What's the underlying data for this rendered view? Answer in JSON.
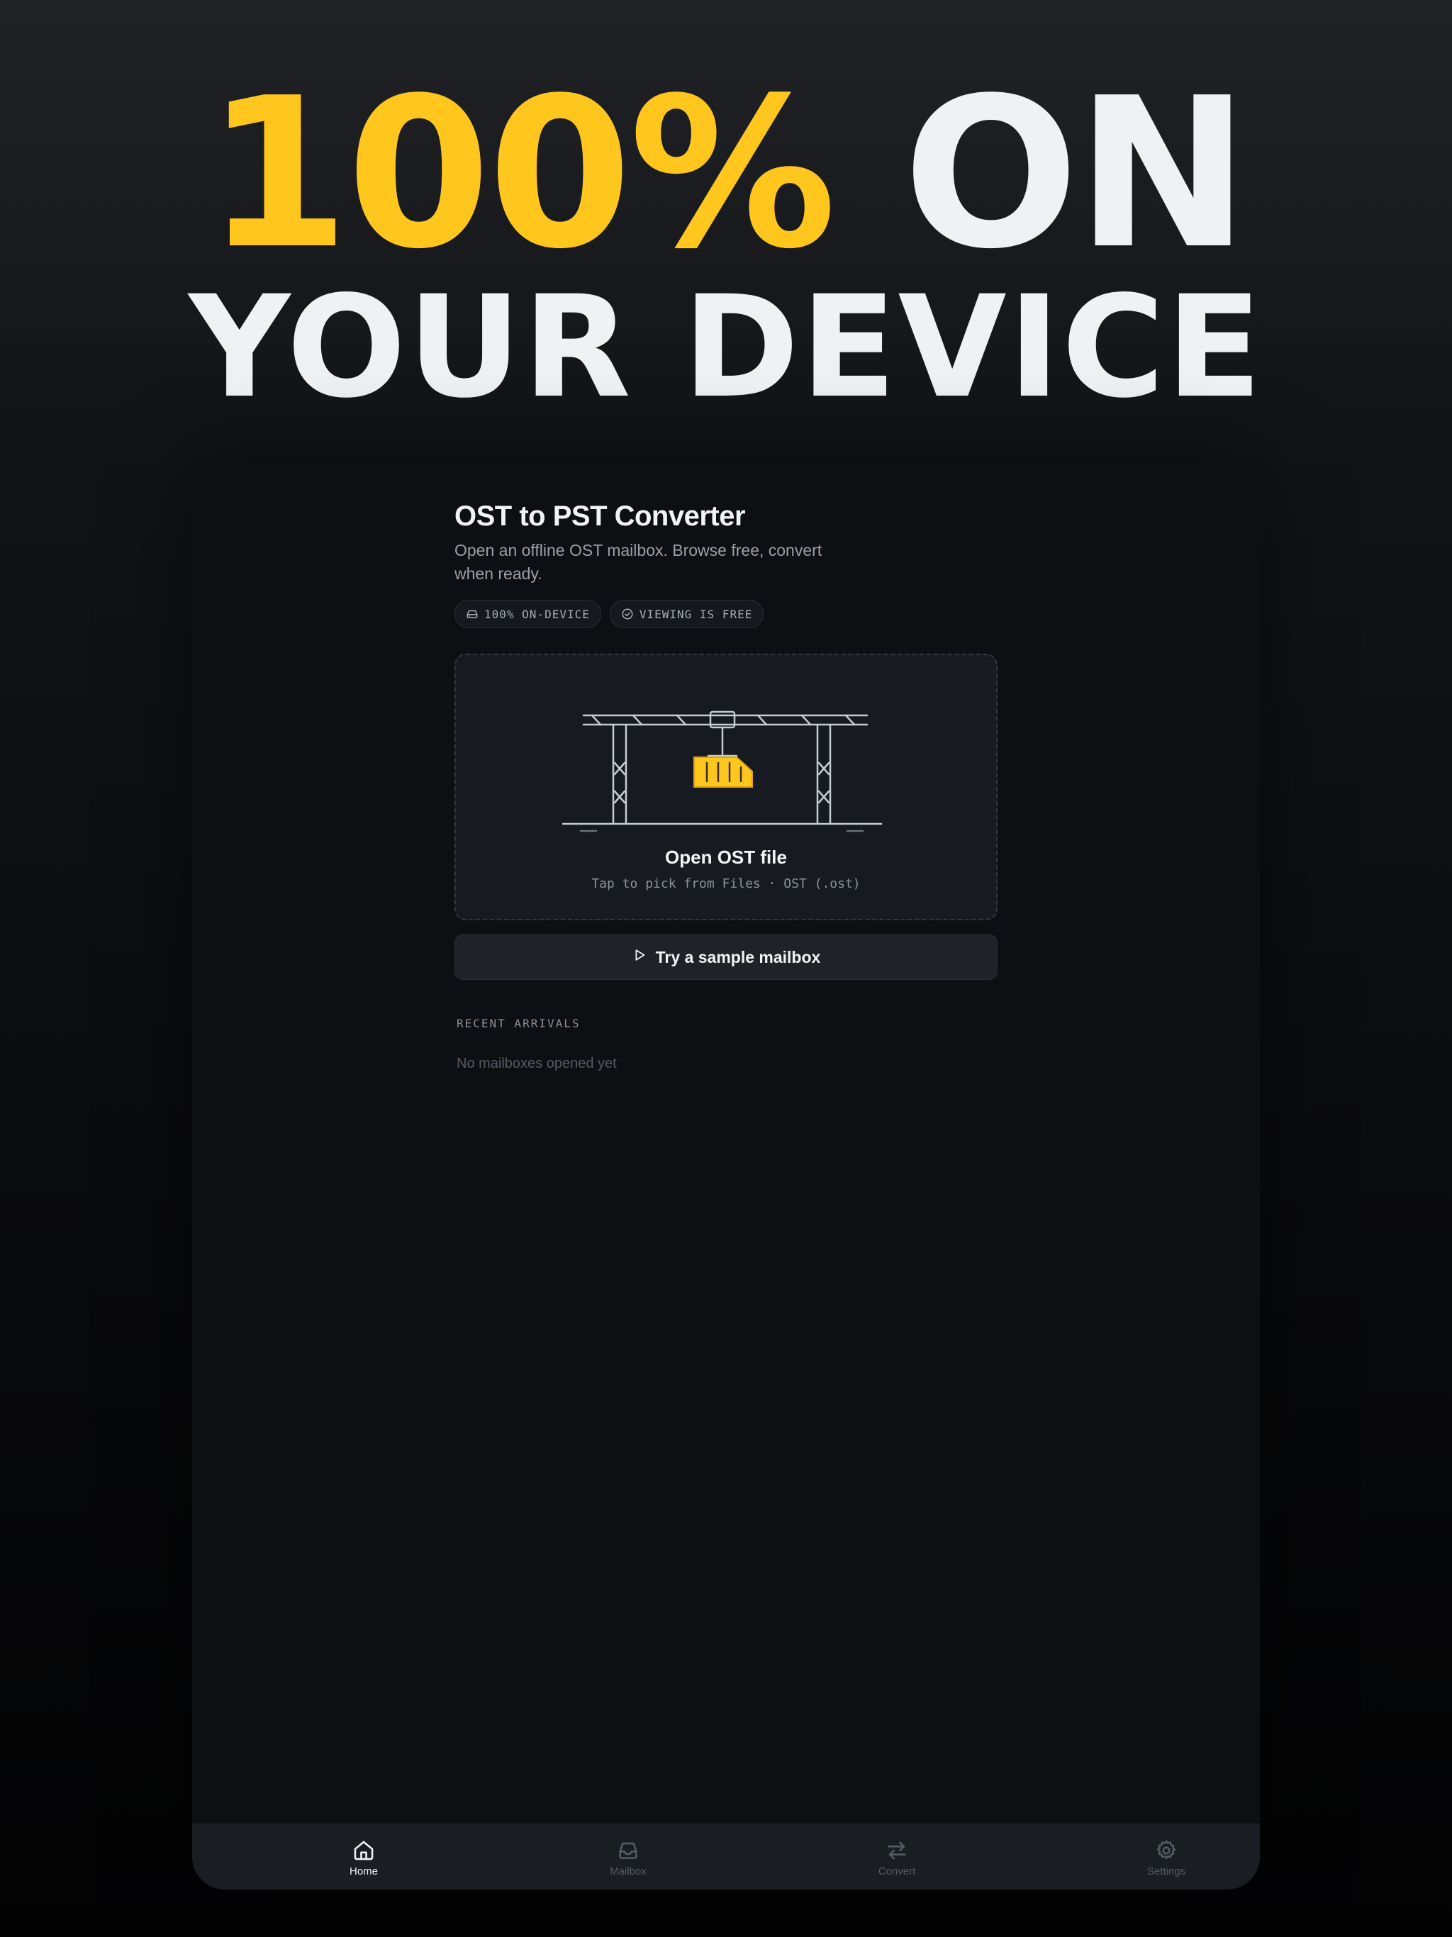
{
  "hero": {
    "accent_text": "100%",
    "line1_rest": "ON",
    "line2": "YOUR DEVICE"
  },
  "app": {
    "title": "OST to PST Converter",
    "subtitle": "Open an offline OST mailbox. Browse free, convert when ready."
  },
  "pills": [
    {
      "label": "100% ON-DEVICE",
      "icon": "drive-icon"
    },
    {
      "label": "VIEWING IS FREE",
      "icon": "check-circle-icon"
    }
  ],
  "dropzone": {
    "title": "Open OST file",
    "hint": "Tap to pick from Files · OST (.ost)",
    "illustration": "gantry-crane-container"
  },
  "sample_button": {
    "label": "Try a sample mailbox",
    "icon": "play-icon"
  },
  "recent": {
    "heading": "RECENT ARRIVALS",
    "empty_text": "No mailboxes opened yet"
  },
  "tabbar": {
    "active": "Home",
    "tabs": [
      {
        "label": "Home",
        "icon": "home-icon"
      },
      {
        "label": "Mailbox",
        "icon": "inbox-icon"
      },
      {
        "label": "Convert",
        "icon": "arrows-swap-icon"
      },
      {
        "label": "Settings",
        "icon": "gear-icon"
      }
    ]
  },
  "colors": {
    "accent": "#ffc61e",
    "background": "#0d0f12",
    "card": "#171a20",
    "text_primary": "#f2f3f5",
    "text_secondary": "#9aa0a8",
    "tab_inactive": "#565c66"
  }
}
